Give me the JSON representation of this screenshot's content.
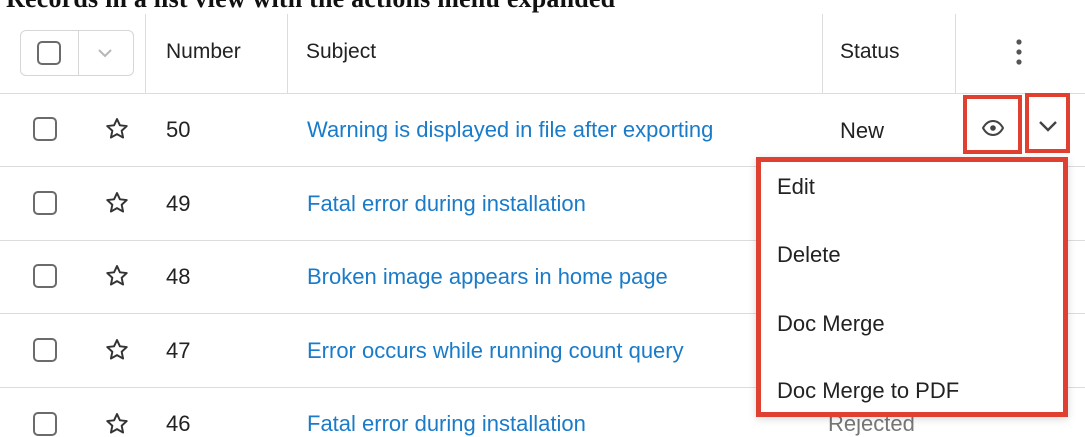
{
  "header": {
    "caption_fragment": "Records in a list view with the actions menu expanded",
    "columns": {
      "number": "Number",
      "subject": "Subject",
      "status": "Status"
    }
  },
  "rows": [
    {
      "number": "50",
      "subject": "Warning is displayed in file after exporting",
      "status": "New"
    },
    {
      "number": "49",
      "subject": "Fatal error during installation",
      "status": ""
    },
    {
      "number": "48",
      "subject": "Broken image appears in home page",
      "status": ""
    },
    {
      "number": "47",
      "subject": "Error occurs while running count query",
      "status": ""
    },
    {
      "number": "46",
      "subject": "Fatal error during installation",
      "status": "Rejected"
    }
  ],
  "actions_menu": {
    "items": [
      "Edit",
      "Delete",
      "Doc Merge",
      "Doc Merge to PDF"
    ]
  },
  "icons": {
    "row_star": "star-outline-icon",
    "preview": "eye-icon",
    "dropdown": "chevron-down-icon",
    "more": "vertical-ellipsis-icon"
  },
  "colors": {
    "link": "#1a7bc9",
    "highlight": "#e0402f"
  }
}
